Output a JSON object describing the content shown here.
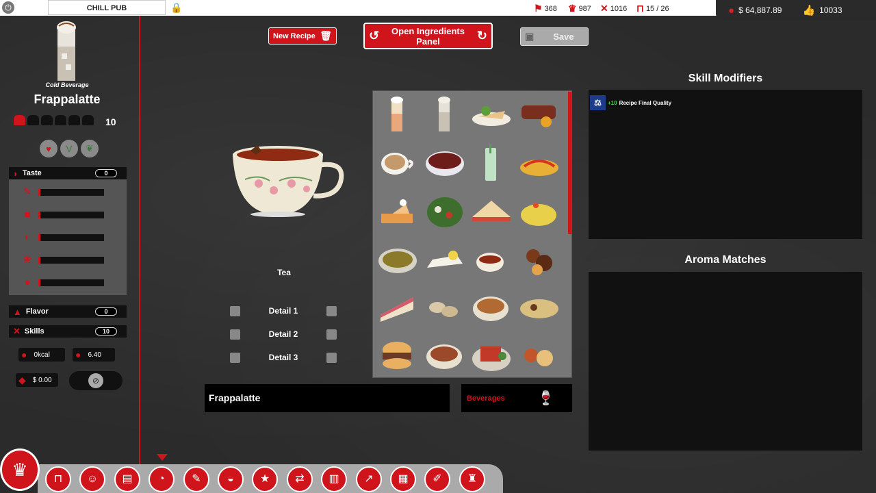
{
  "topbar": {
    "pub_name": "CHILL PUB",
    "stats": [
      {
        "icon": "flag-icon",
        "value": "368"
      },
      {
        "icon": "chef-hat-icon",
        "value": "987"
      },
      {
        "icon": "cutlery-icon",
        "value": "1016"
      },
      {
        "icon": "table-icon",
        "value": "15 / 26"
      }
    ],
    "money": "$ 64,887.89",
    "likes": "10033"
  },
  "left_panel": {
    "category": "Cold Beverage",
    "dish_name": "Frappalatte",
    "hat_rating_filled": 1,
    "hat_rating_total": 5,
    "hat_score": "10",
    "taste": {
      "label": "Taste",
      "value": "0"
    },
    "flavor": {
      "label": "Flavor",
      "value": "0"
    },
    "skills": {
      "label": "Skills",
      "value": "10"
    },
    "kcal": "0kcal",
    "rating": "6.40",
    "price": "$ 0.00"
  },
  "toolbar": {
    "new_recipe": "New Recipe",
    "open_ingredients_line1": "Open Ingredients",
    "open_ingredients_line2": "Panel",
    "save": "Save"
  },
  "preview": {
    "ingredient_name": "Tea"
  },
  "details": [
    {
      "label": "Detail 1"
    },
    {
      "label": "Detail 2"
    },
    {
      "label": "Detail 3"
    }
  ],
  "recipe_name_value": "Frappalatte",
  "category_select": "Beverages",
  "right_panel": {
    "skill_modifiers_title": "Skill Modifiers",
    "modifier_value": "+10",
    "modifier_label": "Recipe Final Quality",
    "aroma_title": "Aroma Matches"
  },
  "colors": {
    "accent": "#d0141c",
    "modifier_green": "#4dcc4d"
  }
}
